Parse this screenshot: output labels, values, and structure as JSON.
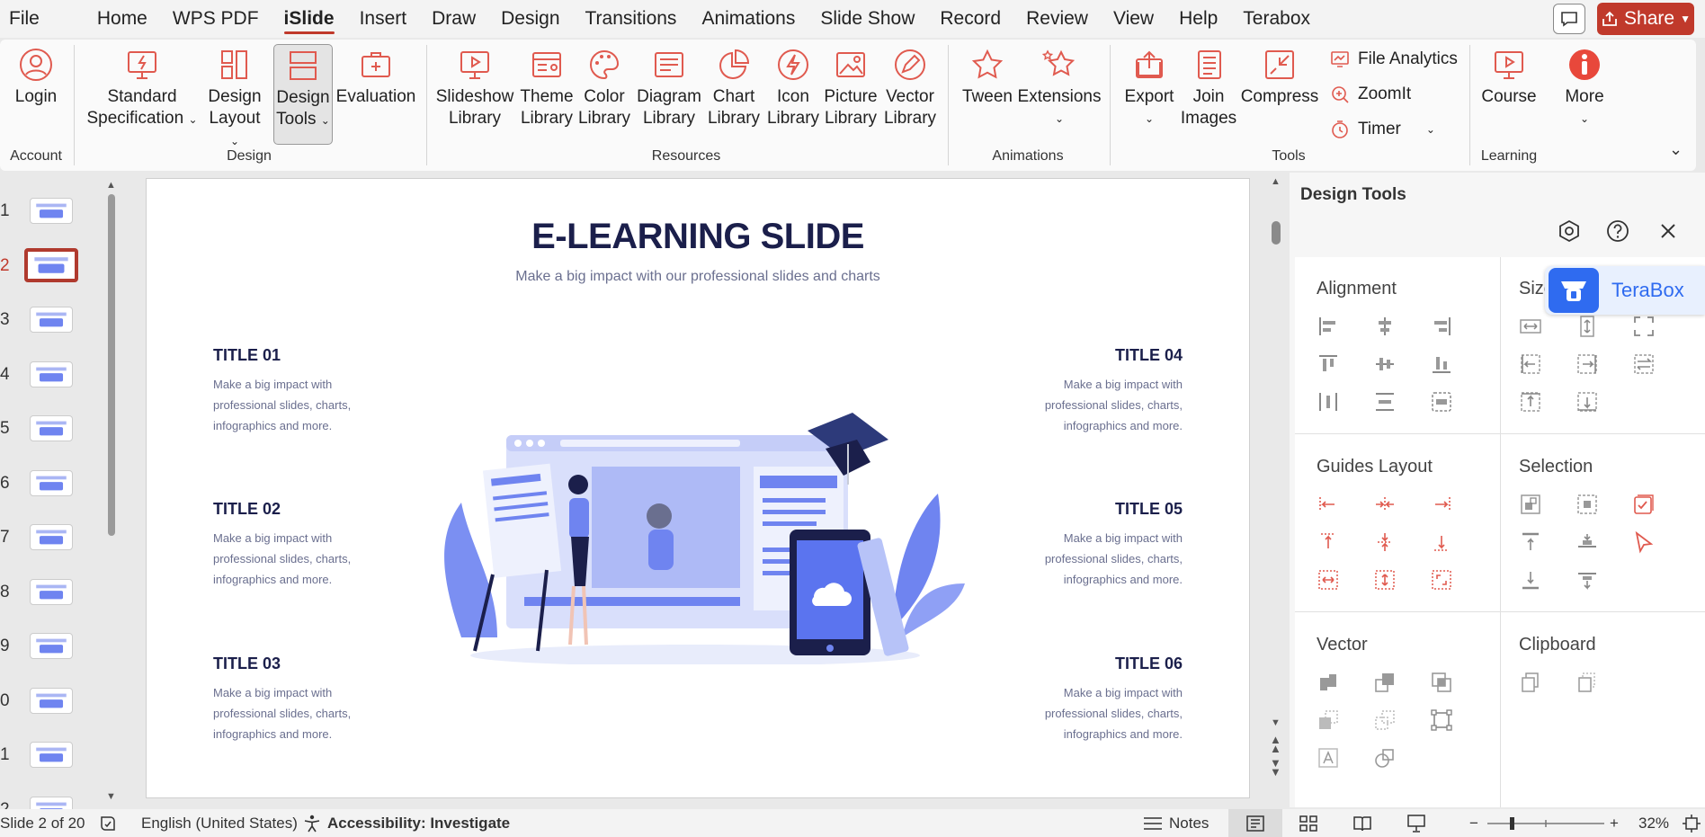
{
  "menu": {
    "tabs": [
      "File",
      "Home",
      "WPS PDF",
      "iSlide",
      "Insert",
      "Draw",
      "Design",
      "Transitions",
      "Animations",
      "Slide Show",
      "Record",
      "Review",
      "View",
      "Help",
      "Terabox"
    ],
    "active": "iSlide",
    "share_label": "Share"
  },
  "ribbon": {
    "login": "Login",
    "standard_spec_1": "Standard",
    "standard_spec_2": "Specification",
    "design_layout_1": "Design",
    "design_layout_2": "Layout",
    "design_tools_1": "Design",
    "design_tools_2": "Tools",
    "evaluation": "Evaluation",
    "slideshow_lib_1": "Slideshow",
    "theme_lib_1": "Theme",
    "color_lib_1": "Color",
    "diagram_lib_1": "Diagram",
    "chart_lib_1": "Chart",
    "icon_lib_1": "Icon",
    "picture_lib_1": "Picture",
    "vector_lib_1": "Vector",
    "library": "Library",
    "tween": "Tween",
    "extensions": "Extensions",
    "export": "Export",
    "join_images_1": "Join",
    "join_images_2": "Images",
    "compress": "Compress",
    "file_analytics": "File Analytics",
    "zoomit": "ZoomIt",
    "timer": "Timer",
    "course": "Course",
    "more": "More",
    "groups": {
      "account": "Account",
      "design": "Design",
      "resources": "Resources",
      "animations": "Animations",
      "tools": "Tools",
      "learning": "Learning"
    }
  },
  "thumbnails": {
    "numbers": [
      "1",
      "2",
      "3",
      "4",
      "5",
      "6",
      "7",
      "8",
      "9",
      "0",
      "1",
      "2"
    ],
    "selected_index": 1
  },
  "slide": {
    "title": "E-LEARNING SLIDE",
    "subtitle": "Make a big impact with our professional slides and charts",
    "blocks": [
      {
        "title": "TITLE 01",
        "l1": "Make a big impact with",
        "l2": "professional slides, charts,",
        "l3": "infographics and more."
      },
      {
        "title": "TITLE 02",
        "l1": "Make a big impact with",
        "l2": "professional slides, charts,",
        "l3": "infographics and more."
      },
      {
        "title": "TITLE 03",
        "l1": "Make a big impact with",
        "l2": "professional slides, charts,",
        "l3": "infographics and more."
      },
      {
        "title": "TITLE 04",
        "l1": "Make a big impact with",
        "l2": "professional slides, charts,",
        "l3": "infographics and more."
      },
      {
        "title": "TITLE 05",
        "l1": "Make a big impact with",
        "l2": "professional slides, charts,",
        "l3": "infographics and more."
      },
      {
        "title": "TITLE 06",
        "l1": "Make a big impact with",
        "l2": "professional slides, charts,",
        "l3": "infographics and more."
      }
    ]
  },
  "panel": {
    "title": "Design Tools",
    "sections": {
      "alignment": "Alignment",
      "size": "Size",
      "guides_layout": "Guides Layout",
      "selection": "Selection",
      "vector": "Vector",
      "clipboard": "Clipboard"
    },
    "terabox": "TeraBox"
  },
  "status": {
    "slide_counter": "Slide 2 of 20",
    "language": "English (United States)",
    "accessibility": "Accessibility: Investigate",
    "notes": "Notes",
    "zoom": "32%"
  },
  "colors": {
    "accent": "#c0392b",
    "slide_title": "#1b1f4b",
    "illustration": "#6f84f0",
    "terabox": "#2f6bf0"
  }
}
